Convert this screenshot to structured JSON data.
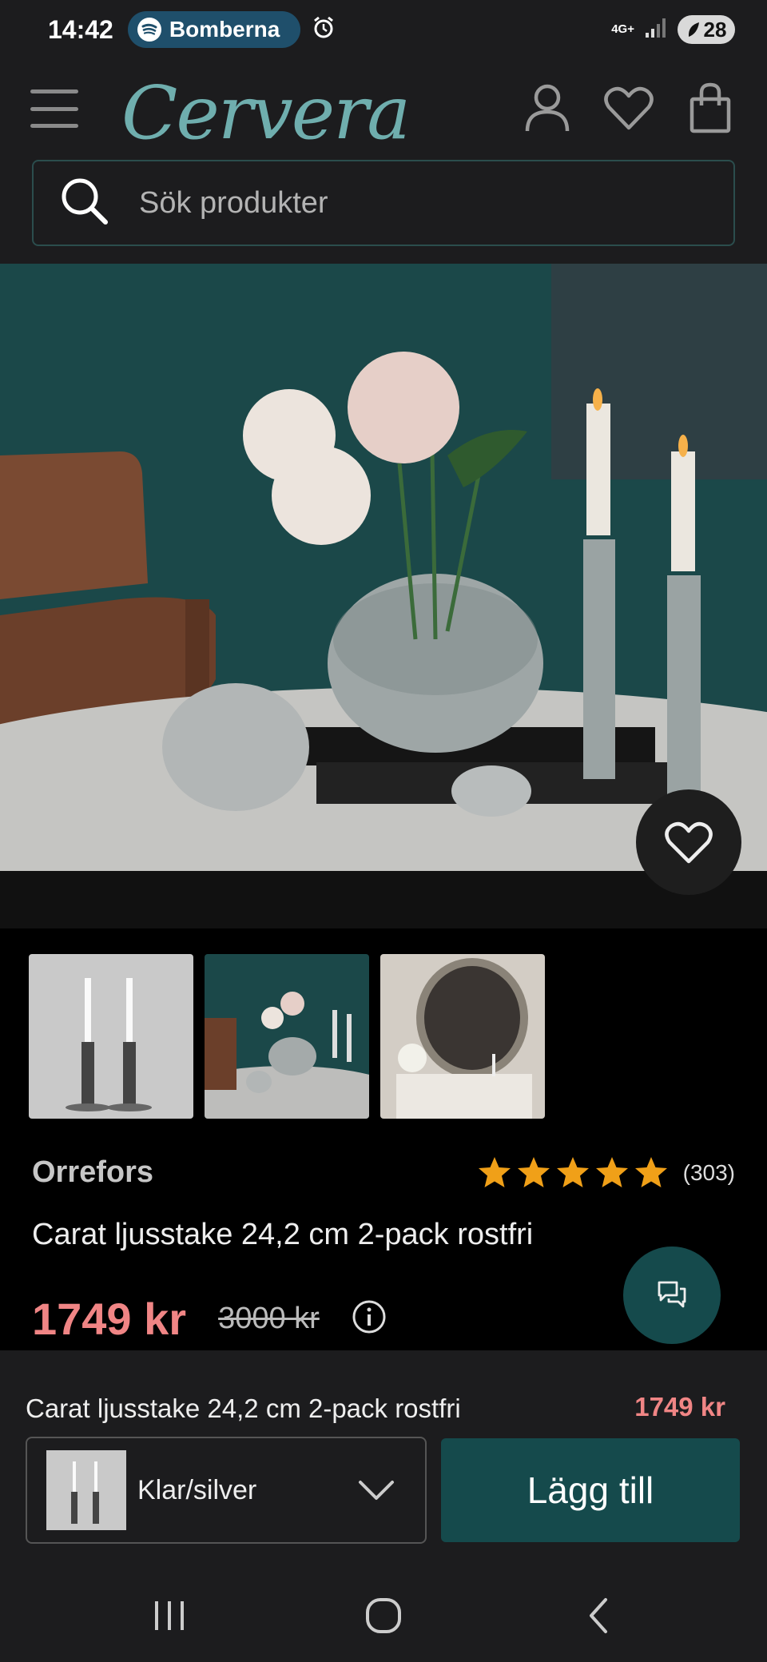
{
  "status": {
    "time": "14:42",
    "media_label": "Bomberna",
    "network": "4G+",
    "battery": "28"
  },
  "header": {
    "logo": "Cervera",
    "search_placeholder": "Sök produkter"
  },
  "product": {
    "brand": "Orrefors",
    "rating": 5,
    "rating_count": "(303)",
    "title": "Carat ljusstake 24,2 cm 2-pack rostfri",
    "price": "1749 kr",
    "old_price": "3000 kr"
  },
  "cart": {
    "title": "Carat ljusstake 24,2 cm 2-pack rostfri",
    "price": "1749 kr",
    "variant": "Klar/silver",
    "add_label": "Lägg till"
  },
  "colors": {
    "accent": "#154a4c",
    "logo": "#6faeae",
    "price": "#f08585",
    "star": "#f0a018"
  }
}
